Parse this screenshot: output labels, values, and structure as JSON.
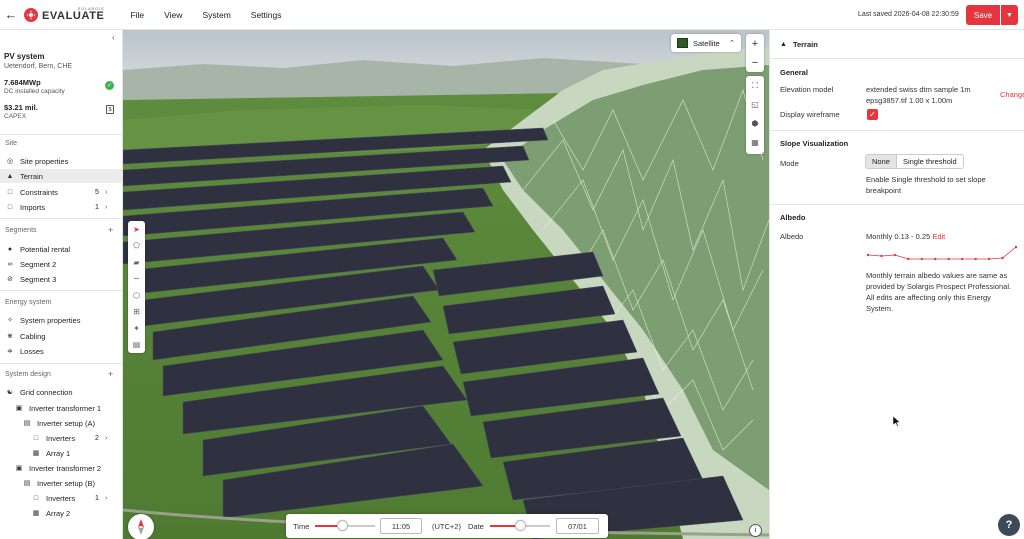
{
  "app": {
    "brand_small": "SOLARGIS",
    "brand_name": "EVALUATE",
    "menu": [
      {
        "label": "File"
      },
      {
        "label": "View"
      },
      {
        "label": "System"
      },
      {
        "label": "Settings"
      }
    ],
    "last_saved": "Last saved 2026-04-08 22:30:59",
    "save_label": "Save"
  },
  "sidebar": {
    "project_title": "PV system",
    "project_location": "Uetendorf, Bern, CHE",
    "capacity_value": "7.684MWp",
    "capacity_label": "DC installed capacity",
    "capex_value": "$3.21 mil.",
    "capex_label": "CAPEX",
    "sections": {
      "site": "Site",
      "segments": "Segments",
      "energy": "Energy system",
      "design": "System design"
    },
    "site_items": [
      {
        "label": "Site properties",
        "icon": "location-icon"
      },
      {
        "label": "Terrain",
        "icon": "mountain-icon"
      },
      {
        "label": "Constraints",
        "icon": "folder-icon",
        "count": "5"
      },
      {
        "label": "Imports",
        "icon": "folder-icon",
        "count": "1"
      }
    ],
    "segment_items": [
      {
        "label": "Potential rental",
        "icon": "globe-icon"
      },
      {
        "label": "Segment 2",
        "icon": "link-icon"
      },
      {
        "label": "Segment 3",
        "icon": "eye-off-icon"
      }
    ],
    "energy_items": [
      {
        "label": "System properties",
        "icon": "bolt-icon"
      },
      {
        "label": "Cabling",
        "icon": "cable-icon"
      },
      {
        "label": "Losses",
        "icon": "losses-icon"
      }
    ],
    "design_items": [
      {
        "label": "Grid connection",
        "icon": "tower-icon"
      },
      {
        "label": "Inverter transformer 1",
        "icon": "transformer-icon"
      },
      {
        "label": "Inverter setup (A)",
        "icon": "inverter-icon"
      },
      {
        "label": "Inverters",
        "icon": "folder-icon",
        "count": "2"
      },
      {
        "label": "Array 1",
        "icon": "grid-icon"
      },
      {
        "label": "Inverter transformer 2",
        "icon": "transformer-icon"
      },
      {
        "label": "Inverter setup (B)",
        "icon": "inverter-icon"
      },
      {
        "label": "Inverters",
        "icon": "folder-icon",
        "count": "1"
      },
      {
        "label": "Array 2",
        "icon": "grid-icon"
      }
    ]
  },
  "map": {
    "layer_label": "Satellite",
    "time_label": "Time",
    "time_value": "11:05",
    "timezone": "(UTC+2)",
    "date_label": "Date",
    "date_value": "07/01",
    "time_slider": 0.45,
    "date_slider": 0.5
  },
  "panel": {
    "title": "Terrain",
    "general_title": "General",
    "elevation_label": "Elevation model",
    "elevation_line1": "extended swiss dtm sample 1m",
    "elevation_line2": "epsg3857.tif 1.00 x 1.00m",
    "change_label": "Change",
    "wireframe_label": "Display wireframe",
    "slope_title": "Slope Visualization",
    "mode_label": "Mode",
    "mode_none": "None",
    "mode_single": "Single threshold",
    "slope_hint_line1": "Enable Single threshold to set slope",
    "slope_hint_line2": "breakpoint",
    "albedo_title": "Albedo",
    "albedo_label": "Albedo",
    "albedo_value": "Monthly 0.13 - 0.25",
    "edit_label": "Edit",
    "albedo_monthly": [
      0.17,
      0.16,
      0.17,
      0.13,
      0.13,
      0.13,
      0.13,
      0.13,
      0.13,
      0.13,
      0.14,
      0.25
    ],
    "albedo_note_line1": "Monthly terrain albedo values are same as",
    "albedo_note_line2": "provided by Solargis Prospect Professional.",
    "albedo_note_line3": "All edits are affecting only this Energy",
    "albedo_note_line4": "System."
  },
  "help_label": "?"
}
